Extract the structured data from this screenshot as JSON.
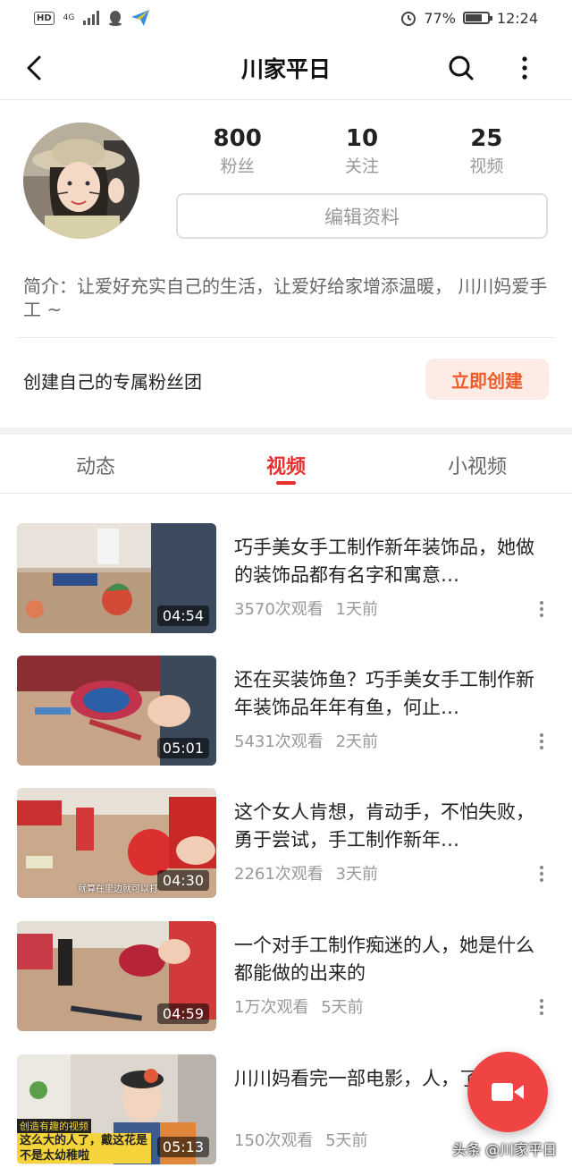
{
  "status_bar": {
    "left_badge": "HD",
    "network": "4G",
    "battery_percent": "77%",
    "battery_level": 0.77,
    "time": "12:24"
  },
  "header": {
    "title": "川家平日"
  },
  "profile": {
    "stats": [
      {
        "value": "800",
        "label": "粉丝"
      },
      {
        "value": "10",
        "label": "关注"
      },
      {
        "value": "25",
        "label": "视频"
      }
    ],
    "edit_label": "编辑资料",
    "bio": "简介：让爱好充实自己的生活，让爱好给家增添温暖，   川川妈爱手工 ~",
    "fan_club_text": "创建自己的专属粉丝团",
    "create_label": "立即创建"
  },
  "tabs": [
    {
      "label": "动态",
      "active": false
    },
    {
      "label": "视频",
      "active": true
    },
    {
      "label": "小视频",
      "active": false
    }
  ],
  "videos": [
    {
      "title": "巧手美女手工制作新年装饰品，她做的装饰品都有名字和寓意…",
      "views": "3570次观看",
      "time": "1天前",
      "duration": "04:54"
    },
    {
      "title": "还在买装饰鱼？巧手美女手工制作新年装饰品年年有鱼，何止…",
      "views": "5431次观看",
      "time": "2天前",
      "duration": "05:01"
    },
    {
      "title": "这个女人肯想，肯动手，不怕失败，勇于尝试，手工制作新年…",
      "views": "2261次观看",
      "time": "3天前",
      "duration": "04:30",
      "caption": "就算在里边就可以打"
    },
    {
      "title": "一个对手工制作痴迷的人，她是什么都能做的出来的",
      "views": "1万次观看",
      "time": "5天前",
      "duration": "04:59"
    },
    {
      "title": "川川妈看完一部电影，人，了，…",
      "views": "150次观看",
      "time": "5天前",
      "duration": "05:13",
      "caption_top": "创造有趣的视频",
      "caption_main": "这么大的人了，戴这花是不是太幼稚啦"
    }
  ],
  "watermark": "头条 @川家平日",
  "colors": {
    "accent": "#e83030",
    "create_bg": "#fdece6",
    "create_text": "#f05a28",
    "fab": "#f04343"
  }
}
